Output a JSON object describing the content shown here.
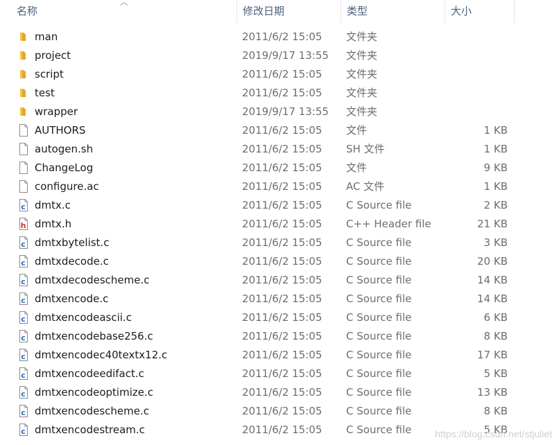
{
  "header": {
    "name": "名称",
    "date": "修改日期",
    "type": "类型",
    "size": "大小",
    "sort_arrow": "︿"
  },
  "files": [
    {
      "icon": "folder-icon",
      "name": "man",
      "date": "2011/6/2 15:05",
      "type": "文件夹",
      "size": ""
    },
    {
      "icon": "folder-icon",
      "name": "project",
      "date": "2019/9/17 13:55",
      "type": "文件夹",
      "size": ""
    },
    {
      "icon": "folder-icon",
      "name": "script",
      "date": "2011/6/2 15:05",
      "type": "文件夹",
      "size": ""
    },
    {
      "icon": "folder-icon",
      "name": "test",
      "date": "2011/6/2 15:05",
      "type": "文件夹",
      "size": ""
    },
    {
      "icon": "folder-icon",
      "name": "wrapper",
      "date": "2019/9/17 13:55",
      "type": "文件夹",
      "size": ""
    },
    {
      "icon": "file-icon",
      "name": "AUTHORS",
      "date": "2011/6/2 15:05",
      "type": "文件",
      "size": "1 KB"
    },
    {
      "icon": "file-icon",
      "name": "autogen.sh",
      "date": "2011/6/2 15:05",
      "type": "SH 文件",
      "size": "1 KB"
    },
    {
      "icon": "file-icon",
      "name": "ChangeLog",
      "date": "2011/6/2 15:05",
      "type": "文件",
      "size": "9 KB"
    },
    {
      "icon": "file-icon",
      "name": "configure.ac",
      "date": "2011/6/2 15:05",
      "type": "AC 文件",
      "size": "1 KB"
    },
    {
      "icon": "c-file-icon",
      "name": "dmtx.c",
      "date": "2011/6/2 15:05",
      "type": "C Source file",
      "size": "2 KB"
    },
    {
      "icon": "h-file-icon",
      "name": "dmtx.h",
      "date": "2011/6/2 15:05",
      "type": "C++ Header file",
      "size": "21 KB"
    },
    {
      "icon": "c-file-icon",
      "name": "dmtxbytelist.c",
      "date": "2011/6/2 15:05",
      "type": "C Source file",
      "size": "3 KB"
    },
    {
      "icon": "c-file-icon",
      "name": "dmtxdecode.c",
      "date": "2011/6/2 15:05",
      "type": "C Source file",
      "size": "20 KB"
    },
    {
      "icon": "c-file-icon",
      "name": "dmtxdecodescheme.c",
      "date": "2011/6/2 15:05",
      "type": "C Source file",
      "size": "14 KB"
    },
    {
      "icon": "c-file-icon",
      "name": "dmtxencode.c",
      "date": "2011/6/2 15:05",
      "type": "C Source file",
      "size": "14 KB"
    },
    {
      "icon": "c-file-icon",
      "name": "dmtxencodeascii.c",
      "date": "2011/6/2 15:05",
      "type": "C Source file",
      "size": "6 KB"
    },
    {
      "icon": "c-file-icon",
      "name": "dmtxencodebase256.c",
      "date": "2011/6/2 15:05",
      "type": "C Source file",
      "size": "8 KB"
    },
    {
      "icon": "c-file-icon",
      "name": "dmtxencodec40textx12.c",
      "date": "2011/6/2 15:05",
      "type": "C Source file",
      "size": "17 KB"
    },
    {
      "icon": "c-file-icon",
      "name": "dmtxencodeedifact.c",
      "date": "2011/6/2 15:05",
      "type": "C Source file",
      "size": "5 KB"
    },
    {
      "icon": "c-file-icon",
      "name": "dmtxencodeoptimize.c",
      "date": "2011/6/2 15:05",
      "type": "C Source file",
      "size": "13 KB"
    },
    {
      "icon": "c-file-icon",
      "name": "dmtxencodescheme.c",
      "date": "2011/6/2 15:05",
      "type": "C Source file",
      "size": "8 KB"
    },
    {
      "icon": "c-file-icon",
      "name": "dmtxencodestream.c",
      "date": "2011/6/2 15:05",
      "type": "C Source file",
      "size": "5 KB"
    }
  ],
  "colors": {
    "folder": "#f4c542",
    "c_badge": "#2a6ebb",
    "h_badge": "#d0302f",
    "header_text": "#4c607a"
  },
  "watermark": "https://blog.csdn.net/stjuliet"
}
